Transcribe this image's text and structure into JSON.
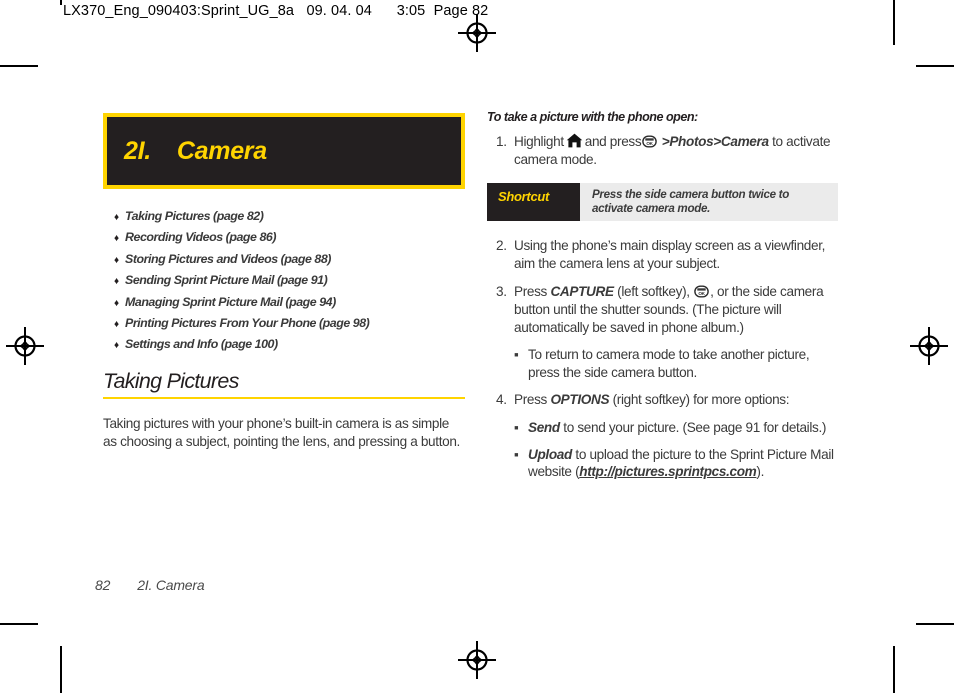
{
  "prepress": {
    "slug": "LX370_Eng_090403:Sprint_UG_8a   09. 04. 04      3:05  Page 82"
  },
  "colors": {
    "accent_yellow": "#ffd400",
    "banner_dark": "#231f20",
    "callout_gray": "#ebebeb",
    "body_text": "#3b3b3b"
  },
  "chapter": {
    "number": "2I.",
    "name": "Camera"
  },
  "contents": [
    {
      "bullet": "♦",
      "label": "Taking Pictures (page 82)"
    },
    {
      "bullet": "♦",
      "label": "Recording Videos (page 86)"
    },
    {
      "bullet": "♦",
      "label": "Storing Pictures and Videos (page 88)"
    },
    {
      "bullet": "♦",
      "label": "Sending Sprint Picture Mail (page 91)"
    },
    {
      "bullet": "♦",
      "label": "Managing Sprint Picture Mail (page 94)"
    },
    {
      "bullet": "♦",
      "label": "Printing Pictures From Your Phone (page 98)"
    },
    {
      "bullet": "♦",
      "label": "Settings and Info (page 100)"
    }
  ],
  "section": {
    "heading": "Taking Pictures",
    "intro": "Taking pictures with your phone’s built-in camera is as simple as choosing a subject, pointing the lens, and pressing a button."
  },
  "procedure": {
    "lead_in": "To take a picture with the phone open:",
    "steps": [
      {
        "num": "1.",
        "pre": "Highlight",
        "icon_home": "home-icon",
        "mid": "and press",
        "icon_ok": "menu-ok-key-icon",
        "path": ">Photos>Camera",
        "post": "to activate camera mode."
      },
      {
        "num": "2.",
        "text": "Using the phone’s main display screen as a viewfinder, aim the camera lens at your subject."
      },
      {
        "num": "3.",
        "pre": "Press",
        "emphasis": "CAPTURE",
        "mid": "(left softkey),",
        "icon_ok": "menu-ok-key-icon",
        "post": ", or the side camera button until the shutter sounds. (The picture will automatically be saved in phone album.)"
      },
      {
        "num": "4.",
        "pre": "Press",
        "emphasis": "OPTIONS",
        "post": "(right softkey) for more options:"
      }
    ],
    "substeps": [
      {
        "bullet": "▪",
        "after_step": "3",
        "text": "To return to camera mode to take another picture, press the side camera button."
      },
      {
        "bullet": "▪",
        "after_step": "4",
        "emphasis": "Send",
        "text": "to send your picture. (See page 91 for details.)"
      },
      {
        "bullet": "▪",
        "after_step": "4",
        "emphasis": "Upload",
        "text_before": "to upload the picture to the Sprint Picture Mail website (",
        "url": "http://pictures.sprintpcs.com",
        "text_after": ")."
      }
    ]
  },
  "shortcut": {
    "label": "Shortcut",
    "body": "Press the side camera button twice to activate camera mode."
  },
  "footer": {
    "page_number": "82",
    "chapter_ref": "2I. Camera"
  }
}
